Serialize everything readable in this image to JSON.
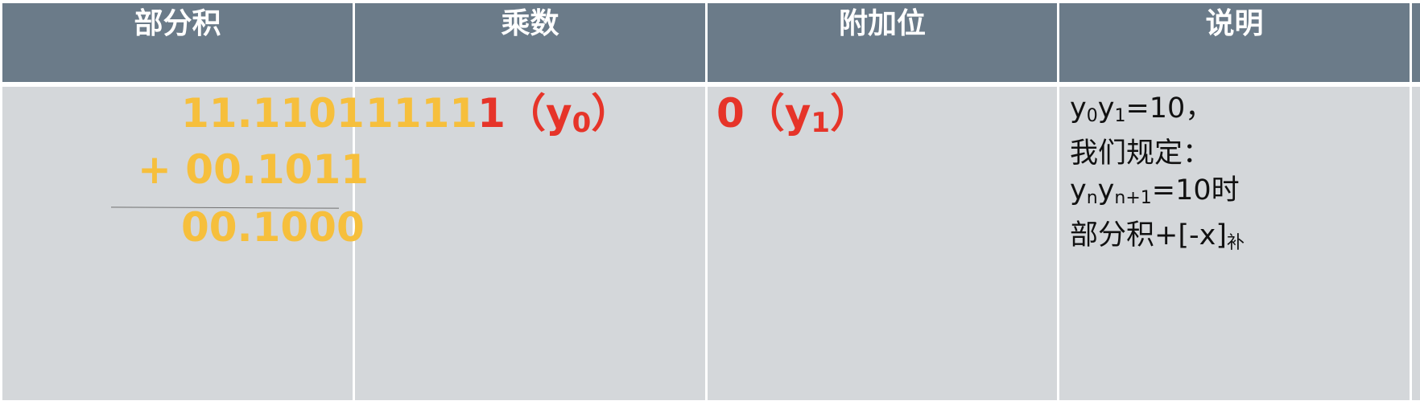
{
  "headers": [
    "部分积",
    "乘数",
    "附加位",
    "说明"
  ],
  "partial_product": {
    "row1": "11.1101",
    "row2": "+ 00.1011",
    "row3": "00.1000"
  },
  "multiplier": {
    "normal_digits": "1111",
    "highlight_digit": "1",
    "label_open": "（y",
    "label_sub": "0",
    "label_close": "）"
  },
  "extra_bit": {
    "value": "0",
    "label_open": "（y",
    "label_sub": "1",
    "label_close": "）"
  },
  "notes": {
    "line1_a": "y",
    "line1_sub_a": "0",
    "line1_b": "y",
    "line1_sub_b": "1",
    "line1_rest": "=10，",
    "line2": "我们规定：",
    "line3_a": "y",
    "line3_sub_a": "n",
    "line3_b": "y",
    "line3_sub_b": "n+1",
    "line3_rest": "=10时",
    "line4_main": "部分积+[-x]",
    "line4_sub": "补"
  },
  "colors": {
    "header_bg": "#6b7b89",
    "cell_bg": "#d4d7da",
    "orange": "#f6bf3c",
    "red": "#e63429"
  }
}
